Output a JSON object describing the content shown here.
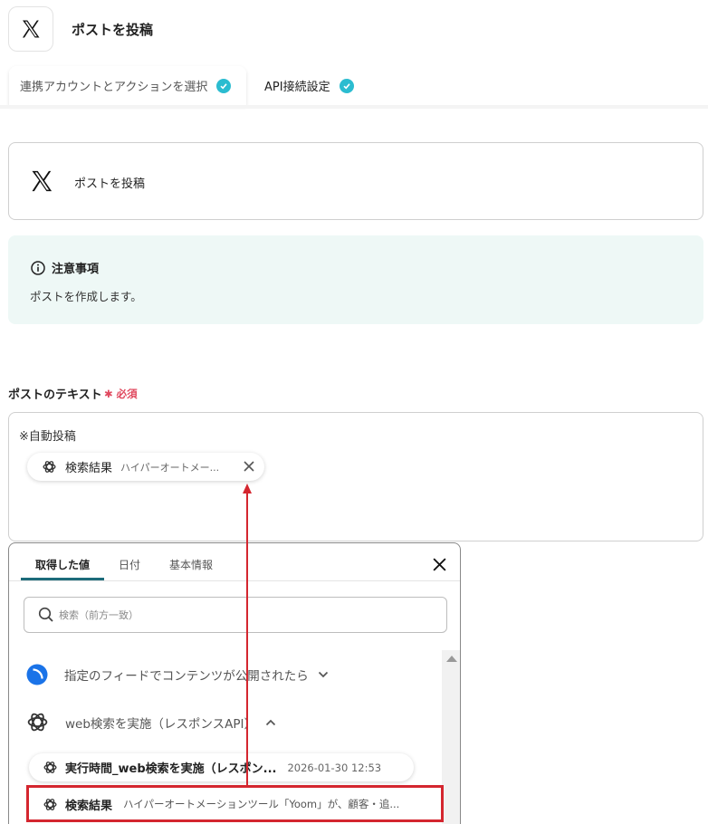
{
  "header": {
    "title": "ポストを投稿",
    "icon": "x-logo-icon"
  },
  "tabs": [
    {
      "label": "連携アカウントとアクションを選択",
      "completed": true
    },
    {
      "label": "API接続設定",
      "completed": true,
      "active": true
    }
  ],
  "action_card": {
    "label": "ポストを投稿",
    "icon": "x-logo-icon"
  },
  "notice": {
    "title": "注意事項",
    "body": "ポストを作成します。"
  },
  "field": {
    "label": "ポストのテキスト",
    "required_label": "必須",
    "text": "※自動投稿",
    "chip": {
      "name": "検索結果",
      "value": "ハイパーオートメー..."
    }
  },
  "dropdown": {
    "tabs": [
      "取得した値",
      "日付",
      "基本情報"
    ],
    "active_tab": "取得した値",
    "search_placeholder": "検索（前方一致）",
    "nodes": [
      {
        "label": "指定のフィードでコンテンツが公開されたら",
        "expanded": false
      },
      {
        "label": "web検索を実施（レスポンスAPI）",
        "expanded": true
      }
    ],
    "items": [
      {
        "name": "実行時間_web検索を実施（レスポン...",
        "value": "2026-01-30 12:53"
      },
      {
        "name": "検索結果",
        "value": "ハイパーオートメーションツール「Yoom」が、顧客・追..."
      }
    ]
  },
  "colors": {
    "accent": "#2bbcd0",
    "required": "#e0485e",
    "notice_bg": "#eef8f6",
    "annotation": "#d4262f",
    "tab_underline": "#1c6b7a"
  }
}
